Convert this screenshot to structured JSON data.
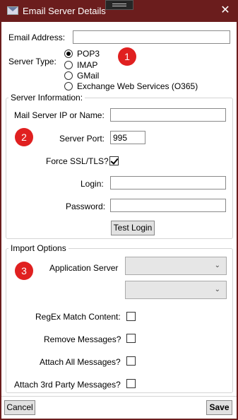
{
  "window": {
    "title": "Email Server Details"
  },
  "email": {
    "label": "Email Address:",
    "value": ""
  },
  "server_type": {
    "label": "Server Type:",
    "options": [
      "POP3",
      "IMAP",
      "GMail",
      "Exchange Web Services (O365)"
    ],
    "selected": "POP3"
  },
  "server_info": {
    "group_label": "Server Information:",
    "mail_server_label": "Mail Server IP or Name:",
    "mail_server_value": "",
    "port_label": "Server Port:",
    "port_value": "995",
    "ssl_label": "Force SSL/TLS?",
    "ssl_checked": true,
    "login_label": "Login:",
    "login_value": "",
    "password_label": "Password:",
    "password_value": "",
    "test_button": "Test Login"
  },
  "import_options": {
    "group_label": "Import Options",
    "app_server_label": "Application Server",
    "regex_label": "RegEx Match Content:",
    "remove_label": "Remove Messages?",
    "attach_all_label": "Attach All Messages?",
    "attach_3rd_label": "Attach 3rd Party Messages?"
  },
  "badges": [
    "1",
    "2",
    "3"
  ],
  "footer": {
    "cancel": "Cancel",
    "save": "Save"
  },
  "colors": {
    "titlebar": "#6b1d1d",
    "badge": "#e02020"
  }
}
